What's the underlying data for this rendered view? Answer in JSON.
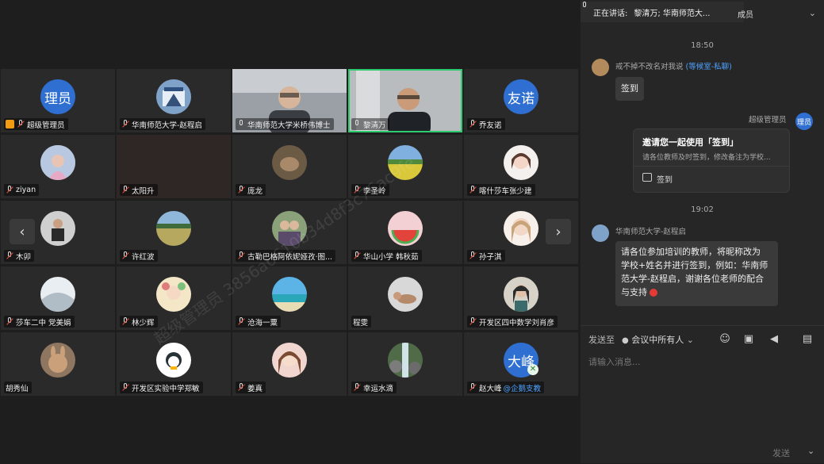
{
  "tiles": [
    {
      "name": "超级管理员",
      "avatar_text": "理员"
    },
    {
      "name": "华南师范大学-赵程启"
    },
    {
      "name": "华南师范大学米桥伟博士"
    },
    {
      "name": "黎清万"
    },
    {
      "name": "乔友诺",
      "avatar_text": "友诺"
    },
    {
      "name": "ziyan"
    },
    {
      "name": "太阳升"
    },
    {
      "name": "庞龙"
    },
    {
      "name": "李圣岭"
    },
    {
      "name": "喀什莎车张少建"
    },
    {
      "name": "木卯"
    },
    {
      "name": "许红波"
    },
    {
      "name": "古勒巴格阿依妮娅孜·图..."
    },
    {
      "name": "华山小学 韩秋茹"
    },
    {
      "name": "孙子淇"
    },
    {
      "name": "莎车二中 党美娟"
    },
    {
      "name": "林少辉"
    },
    {
      "name": "沧海一粟"
    },
    {
      "name": "程雯"
    },
    {
      "name": "开发区四中数学刘肖彦"
    },
    {
      "name": "胡秀仙"
    },
    {
      "name": "开发区实验中学郑敏"
    },
    {
      "name": "姜真"
    },
    {
      "name": "幸运水滴"
    },
    {
      "name": "赵大峰",
      "avatar_text": "大峰",
      "tag": "@企鹅支教"
    }
  ],
  "watermark": "超级管理员 3856a6610b34d8f3c76ac9fe",
  "nav": {
    "prev": "‹",
    "next": "›"
  },
  "panel": {
    "speaking_label": "正在讲话:",
    "speaking_names": "黎清万; 华南师范大...",
    "members_label": "成员",
    "time1": "18:50",
    "msg1_sender": "戒不掉不改名对我说",
    "msg1_link": "(等候室-私聊)",
    "msg1_text": "签到",
    "msg2_sender": "超级管理员",
    "msg2_avatar": "理员",
    "card_title": "邀请您一起使用「签到」",
    "card_desc": "请各位教师及时签到，修改备注为学校...",
    "card_action": "签到",
    "time2": "19:02",
    "msg3_sender": "华南师范大学-赵程启",
    "msg3_l1": "请各位参加培训的教师，将昵称改为",
    "msg3_l2": "学校+姓名并进行签到，例如：华南师",
    "msg3_l3": "范大学-赵程启，谢谢各位老师的配合",
    "msg3_l4": "与支持",
    "send_to_label": "发送至",
    "send_to_value": "会议中所有人",
    "input_placeholder": "请输入消息...",
    "send_button": "发送"
  }
}
